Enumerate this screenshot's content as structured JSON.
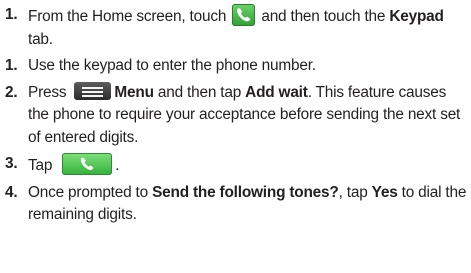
{
  "steps": [
    {
      "number": "1.",
      "before": "From the Home screen, touch ",
      "icon": "phone-app-icon",
      "middle": " and then touch the ",
      "bold": "Keypad",
      "after": " tab."
    },
    {
      "number": "1.",
      "text": "Use the keypad to enter the phone number."
    },
    {
      "number": "2.",
      "before": "Press ",
      "icon": "menu-key-icon",
      "bold1": "Menu",
      "middle": " and then tap ",
      "bold2": "Add wait",
      "after": ". This feature causes the phone to require your acceptance before sending the next set of entered digits."
    },
    {
      "number": "3.",
      "before": "Tap ",
      "icon": "call-button-icon",
      "after": "."
    },
    {
      "number": "4.",
      "before": "Once prompted to ",
      "bold1": "Send the following tones?",
      "middle": ", tap ",
      "bold2": "Yes",
      "after": " to dial the remaining digits."
    }
  ],
  "colors": {
    "text": "#231f20",
    "phone_green": "#3cab3f",
    "menu_key": "#3a3a3a"
  }
}
